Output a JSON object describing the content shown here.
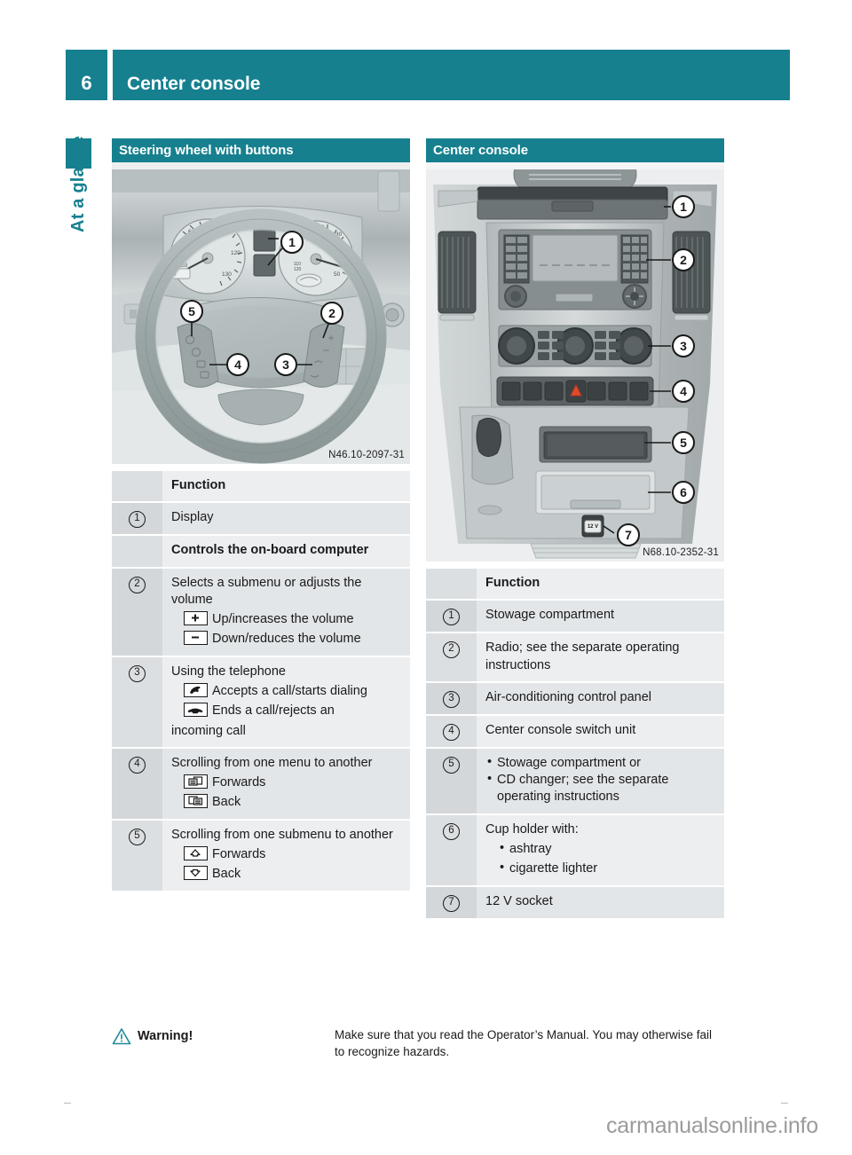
{
  "header": {
    "page_number": "6",
    "title": "Center console"
  },
  "chapter_tab": {
    "label": "At a glance"
  },
  "left_column": {
    "section_title": "Steering wheel with buttons",
    "figure_caption": "N46.10-2097-31",
    "figure_callouts": [
      "1",
      "2",
      "3",
      "4",
      "5"
    ],
    "table_header": "Function",
    "rows": [
      {
        "num": "",
        "text": "Function",
        "bold": true
      },
      {
        "num": "1",
        "text": "Display"
      },
      {
        "num": "",
        "text": "Controls the on-board computer",
        "bold": true
      },
      {
        "num": "2",
        "text": "Selects a submenu or adjusts the volume",
        "sublines": [
          {
            "glyph": "plus-key-icon",
            "text": "Up/increases the volume"
          },
          {
            "glyph": "minus-key-icon",
            "text": "Down/reduces the volume"
          }
        ]
      },
      {
        "num": "3",
        "text": "Using the telephone",
        "sublines": [
          {
            "glyph": "phone-accept-key-icon",
            "text": "Accepts a call/starts dialing"
          },
          {
            "glyph": "phone-end-key-icon",
            "text": "Ends a call/rejects an"
          },
          {
            "glyph": "",
            "text": "incoming call"
          }
        ]
      },
      {
        "num": "4",
        "text": "Scrolling from one menu to another",
        "sublines": [
          {
            "glyph": "pages-forward-key-icon",
            "text": "Forwards"
          },
          {
            "glyph": "pages-back-key-icon",
            "text": "Back"
          }
        ]
      },
      {
        "num": "5",
        "text": "Scrolling from one submenu to another",
        "sublines": [
          {
            "glyph": "arrow-up-key-icon",
            "text": "Forwards"
          },
          {
            "glyph": "arrow-down-key-icon",
            "text": "Back"
          }
        ]
      }
    ]
  },
  "right_column": {
    "section_title": "Center console",
    "figure_caption": "N68.10-2352-31",
    "figure_callouts": [
      "1",
      "2",
      "3",
      "4",
      "5",
      "6",
      "7"
    ],
    "table_header": "Function",
    "rows": [
      {
        "num": "",
        "text": "Function",
        "bold": true
      },
      {
        "num": "1",
        "text": "Stowage compartment"
      },
      {
        "num": "2",
        "text": "Radio; see the separate operating instructions"
      },
      {
        "num": "3",
        "text": "Air-conditioning control panel"
      },
      {
        "num": "4",
        "text": "Center console switch unit"
      },
      {
        "num": "5",
        "text": "",
        "bullets": [
          "Stowage compartment or",
          "CD changer; see the separate operating instructions"
        ]
      },
      {
        "num": "6",
        "text": "Cup holder with:",
        "bullets": [
          "ashtray",
          "cigarette lighter"
        ]
      },
      {
        "num": "7",
        "text": "12 V socket"
      }
    ]
  },
  "warning": {
    "icon": "warning-triangle-icon",
    "label": "Warning!",
    "text": "Make sure that you read the Operator’s Manual. You may otherwise fail to recognize hazards."
  },
  "watermark": {
    "text": "carmanualsonline.info"
  },
  "colors": {
    "teal": "#16808f",
    "table_num_bg": "#dcdfe1",
    "table_text_bg": "#eceef0",
    "table_num_bg_alt": "#d3d7da",
    "table_text_bg_alt": "#e3e6e8",
    "figure_bg": "#e8ebec",
    "watermark_gray": "#9b9b9b"
  }
}
